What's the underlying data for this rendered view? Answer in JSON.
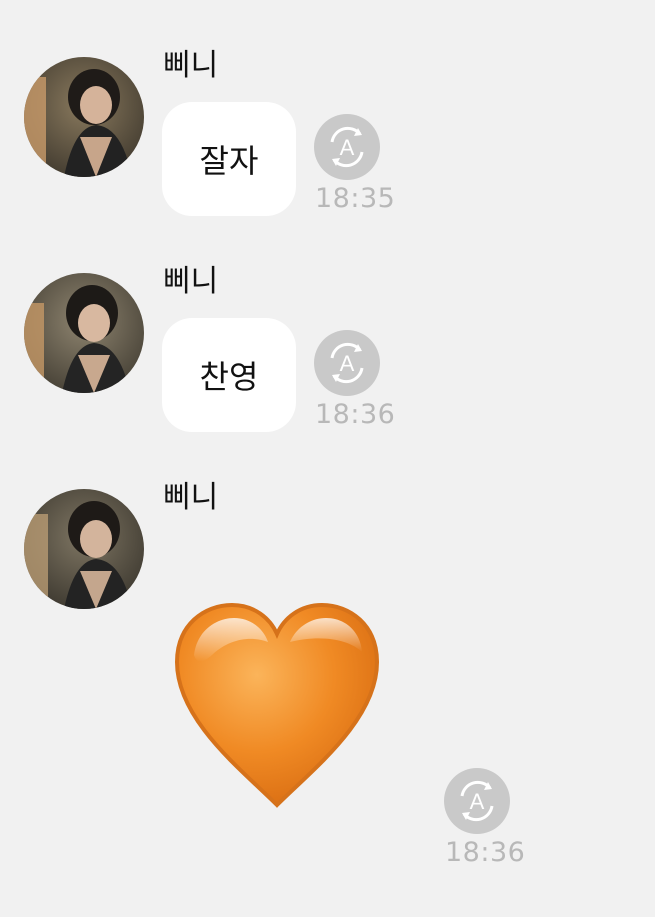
{
  "messages": [
    {
      "sender": "삐니",
      "text": "잘자",
      "time": "18:35"
    },
    {
      "sender": "삐니",
      "text": "찬영",
      "time": "18:36"
    },
    {
      "sender": "삐니",
      "emoji": "orange-heart",
      "time": "18:36"
    }
  ],
  "icons": {
    "translate": "auto-translate-icon",
    "heart": "orange-heart-emoji"
  },
  "colors": {
    "background": "#f1f1f1",
    "bubble": "#ffffff",
    "timestamp": "#b8b8b8",
    "icon": "#c9c9c9",
    "heart": "#f08a24"
  }
}
